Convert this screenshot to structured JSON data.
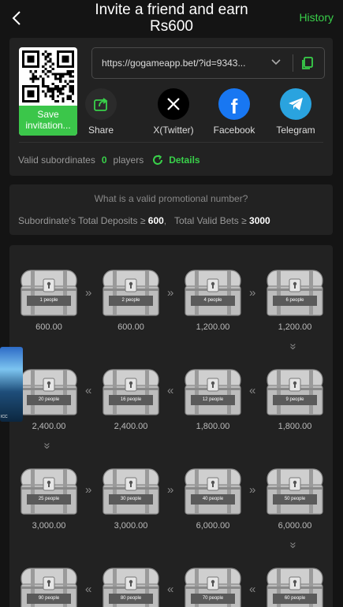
{
  "header": {
    "title_line1": "Invite a friend and earn",
    "title_line2": "Rs600",
    "history": "History"
  },
  "invite": {
    "save_label": "Save invitation...",
    "link": "https://gogameapp.bet/?id=9343...",
    "shares": [
      {
        "label": "Share",
        "icon": "share-icon"
      },
      {
        "label": "X(Twitter)",
        "icon": "x-icon"
      },
      {
        "label": "Facebook",
        "icon": "facebook-icon"
      },
      {
        "label": "Telegram",
        "icon": "telegram-icon"
      }
    ],
    "valid_label": "Valid subordinates",
    "valid_count": "0",
    "valid_unit": "players",
    "details": "Details"
  },
  "rules": {
    "question": "What is a valid promotional number?",
    "deposits_label": "Subordinate's Total Deposits ≥",
    "deposits_value": "600",
    "separator": ",",
    "bets_label": "Total Valid Bets ≥",
    "bets_value": "3000"
  },
  "tiers": [
    {
      "people": "1 people",
      "amount": "600.00"
    },
    {
      "people": "2 people",
      "amount": "600.00"
    },
    {
      "people": "4 people",
      "amount": "1,200.00"
    },
    {
      "people": "6 people",
      "amount": "1,200.00"
    },
    {
      "people": "9 people",
      "amount": "1,800.00"
    },
    {
      "people": "12 people",
      "amount": "1,800.00"
    },
    {
      "people": "16 people",
      "amount": "2,400.00"
    },
    {
      "people": "20 people",
      "amount": "2,400.00"
    },
    {
      "people": "25 people",
      "amount": "3,000.00"
    },
    {
      "people": "30 people",
      "amount": "3,000.00"
    },
    {
      "people": "40 people",
      "amount": "6,000.00"
    },
    {
      "people": "50 people",
      "amount": "6,000.00"
    },
    {
      "people": "60 people",
      "amount": ""
    },
    {
      "people": "70 people",
      "amount": ""
    },
    {
      "people": "80 people",
      "amount": ""
    },
    {
      "people": "90 people",
      "amount": ""
    }
  ],
  "colors": {
    "accent": "#39d04a",
    "card": "#222222",
    "background": "#141414"
  },
  "floating_ad": {
    "label": "ICC"
  }
}
